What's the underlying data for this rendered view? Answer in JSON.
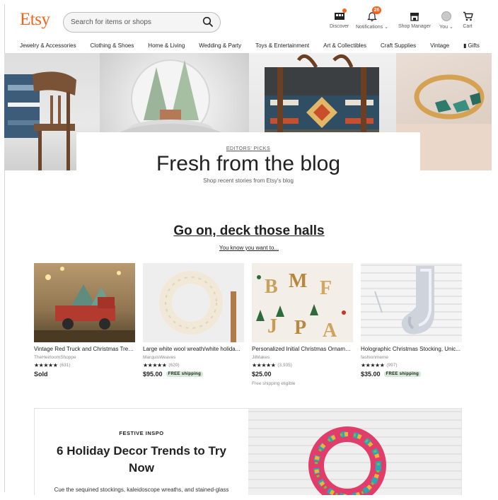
{
  "brand": {
    "logo": "Etsy",
    "accent": "#f1641e"
  },
  "search": {
    "placeholder": "Search for items or shops"
  },
  "header_nav": {
    "discover": "Discover",
    "notifications": "Notifications",
    "notifications_count": "26",
    "shop_manager": "Shop Manager",
    "you": "You",
    "cart": "Cart"
  },
  "categories": [
    "Jewelry & Accessories",
    "Clothing & Shoes",
    "Home & Living",
    "Wedding & Party",
    "Toys & Entertainment",
    "Art & Collectibles",
    "Craft Supplies",
    "Vintage",
    "Gifts"
  ],
  "hero": {
    "eyebrow": "EDITORS' PICKS",
    "title": "Fresh from the blog",
    "subtitle": "Shop recent stories from Etsy's blog"
  },
  "section": {
    "title": "Go on, deck those halls",
    "link": "You know you want to..."
  },
  "products": [
    {
      "title": "Vintage Red Truck and Christmas Tree...",
      "shop": "TheHeirloomShoppe",
      "stars": "★★★★★",
      "reviews": "(631)",
      "price": "Sold",
      "shipping": "",
      "extra": ""
    },
    {
      "title": "Large white wool wreath/white holida...",
      "shop": "MarquisWeaves",
      "stars": "★★★★★",
      "reviews": "(620)",
      "price": "$95.00",
      "shipping": "FREE shipping",
      "extra": ""
    },
    {
      "title": "Personalized Initial Christmas Orname...",
      "shop": "JilMakes",
      "stars": "★★★★★",
      "reviews": "(3,935)",
      "price": "$25.00",
      "shipping": "",
      "extra": "Free shipping eligible"
    },
    {
      "title": "Holographic Christmas Stocking, Unic...",
      "shop": "fashionmeme",
      "stars": "★★★★★",
      "reviews": "(997)",
      "price": "$35.00",
      "shipping": "FREE shipping",
      "extra": ""
    }
  ],
  "article": {
    "eyebrow": "FESTIVE INSPO",
    "title": "6 Holiday Decor Trends to Try Now",
    "body": "Cue the sequined stockings, kaleidoscope wreaths, and stained-glass menorahs: The time to decorate has officially arrived, and Etsy sellers"
  }
}
